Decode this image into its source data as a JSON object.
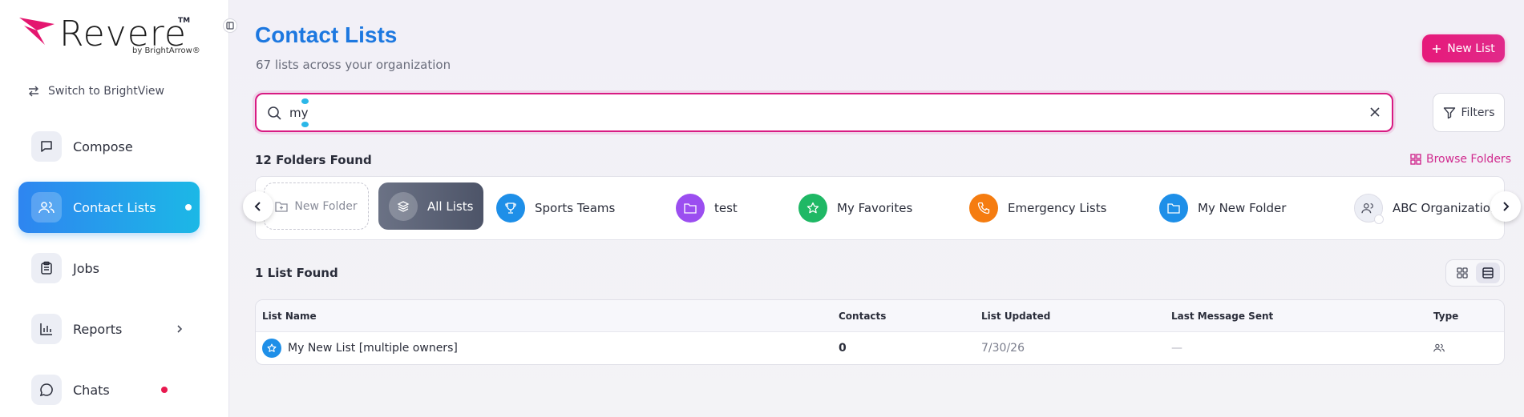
{
  "brand": {
    "name": "Revere",
    "tm": "TM",
    "byline": "by BrightArrow®"
  },
  "sidebar": {
    "switch_label": "Switch to BrightView",
    "items": [
      {
        "label": "Compose",
        "icon": "chat-square-icon"
      },
      {
        "label": "Contact Lists",
        "icon": "users-icon",
        "active": true
      },
      {
        "label": "Jobs",
        "icon": "clipboard-icon"
      },
      {
        "label": "Reports",
        "icon": "bar-chart-icon"
      },
      {
        "label": "Chats",
        "icon": "chat-bubble-icon"
      }
    ]
  },
  "header": {
    "title": "Contact Lists",
    "subtitle": "67 lists across your organization",
    "new_list_label": "New List"
  },
  "search": {
    "value": "my",
    "filters_label": "Filters"
  },
  "folders": {
    "count_label": "12 Folders Found",
    "browse_label": "Browse Folders",
    "new_folder_label": "New Folder",
    "all_lists_label": "All Lists",
    "items": [
      {
        "label": "Sports Teams",
        "color": "#1e8fe8",
        "icon": "trophy-icon"
      },
      {
        "label": "test",
        "color": "#9b4ef0",
        "icon": "folder-icon"
      },
      {
        "label": "My Favorites",
        "color": "#1fb865",
        "icon": "star-icon"
      },
      {
        "label": "Emergency Lists",
        "color": "#f57c10",
        "icon": "phone-icon"
      },
      {
        "label": "My New Folder",
        "color": "#1e8fe8",
        "icon": "folder-icon"
      },
      {
        "label": "ABC Organization",
        "color": "#eceef5",
        "icon": "users-lock-icon"
      }
    ]
  },
  "lists": {
    "count_label": "1 List Found",
    "columns": [
      "List Name",
      "Contacts",
      "List Updated",
      "Last Message Sent",
      "Type"
    ],
    "rows": [
      {
        "name": "My New List [multiple owners]",
        "contacts": "0",
        "updated": "7/30/26",
        "last_sent": "—",
        "type_icon": "users-icon"
      }
    ]
  },
  "colors": {
    "accent_blue": "#1d78e0",
    "accent_pink": "#e6197a",
    "chats_badge": "#e8194f"
  }
}
